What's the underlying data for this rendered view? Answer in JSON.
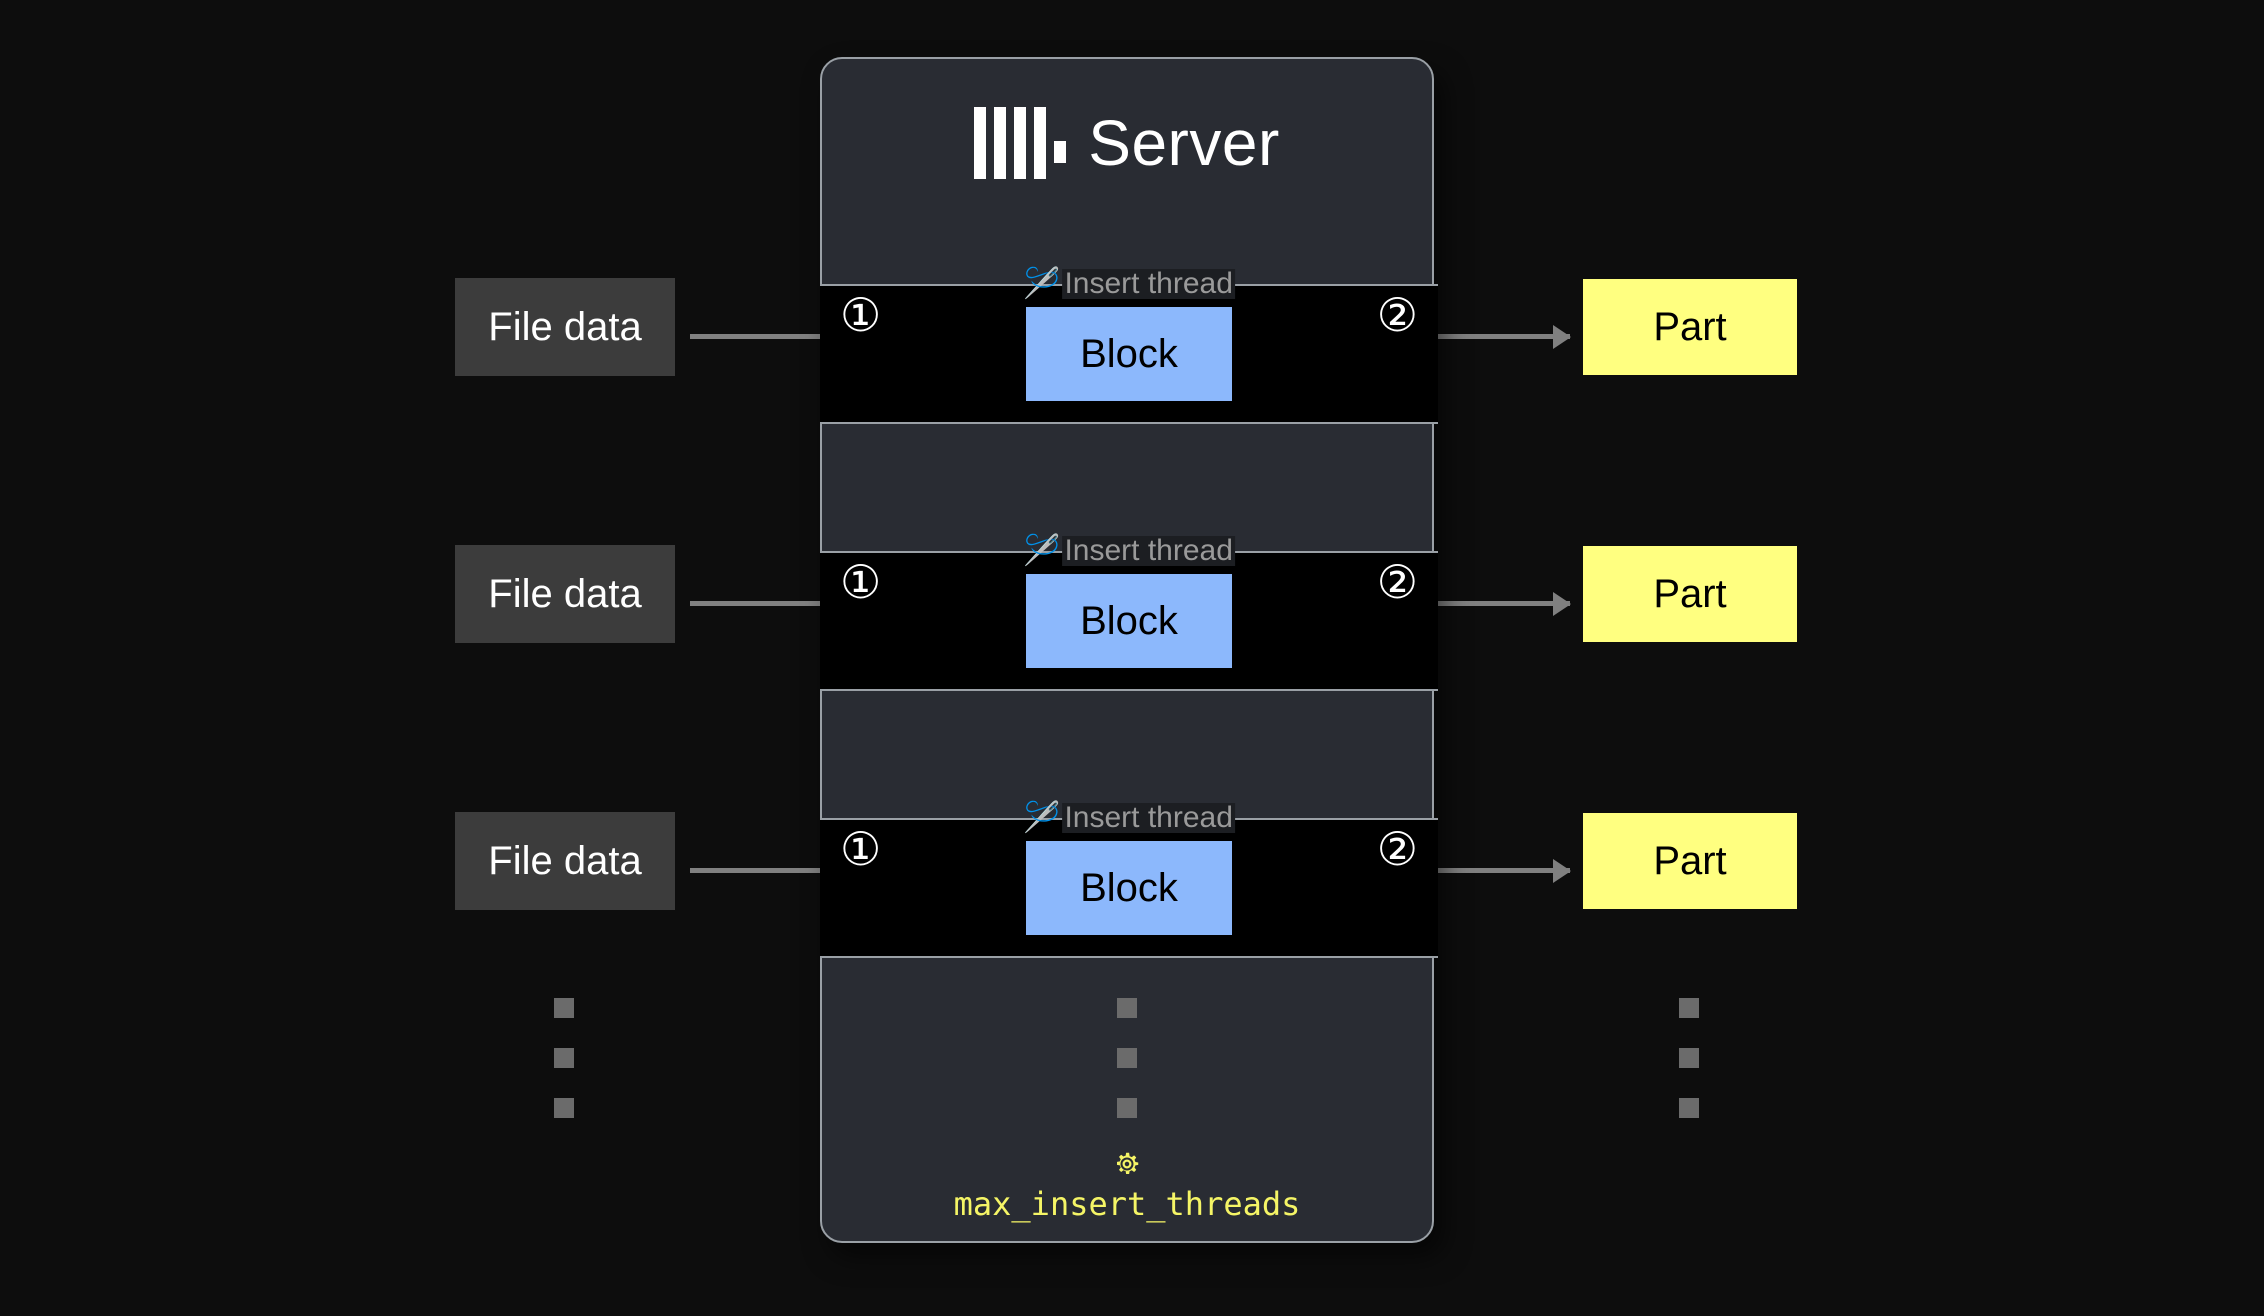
{
  "page": {
    "background_color": "#0d0d0d"
  },
  "server": {
    "title": "Server",
    "logo_icon": "clickhouse-logo-icon",
    "panel_color": "#292c33",
    "border_color": "#9aa0a6"
  },
  "threads": [
    {
      "label": "Insert thread",
      "spool_icon": "🪡",
      "step_in": "①",
      "step_out": "②",
      "block_label": "Block",
      "input_label": "File data",
      "output_label": "Part"
    },
    {
      "label": "Insert thread",
      "spool_icon": "🪡",
      "step_in": "①",
      "step_out": "②",
      "block_label": "Block",
      "input_label": "File data",
      "output_label": "Part"
    },
    {
      "label": "Insert thread",
      "spool_icon": "🪡",
      "step_in": "①",
      "step_out": "②",
      "block_label": "Block",
      "input_label": "File data",
      "output_label": "Part"
    }
  ],
  "setting": {
    "gear_icon": "gear-icon",
    "name": "max_insert_threads",
    "color": "#f5f566"
  },
  "colors": {
    "block_fill": "#8cb8fc",
    "part_fill": "#ffff80",
    "file_fill": "#3c3c3c",
    "arrow": "#808080",
    "thread_row_fill": "#000000",
    "ellipsis_square": "#6b6b6b"
  },
  "ellipsis": {
    "square_count": 3,
    "columns": [
      "left",
      "center",
      "right"
    ]
  }
}
